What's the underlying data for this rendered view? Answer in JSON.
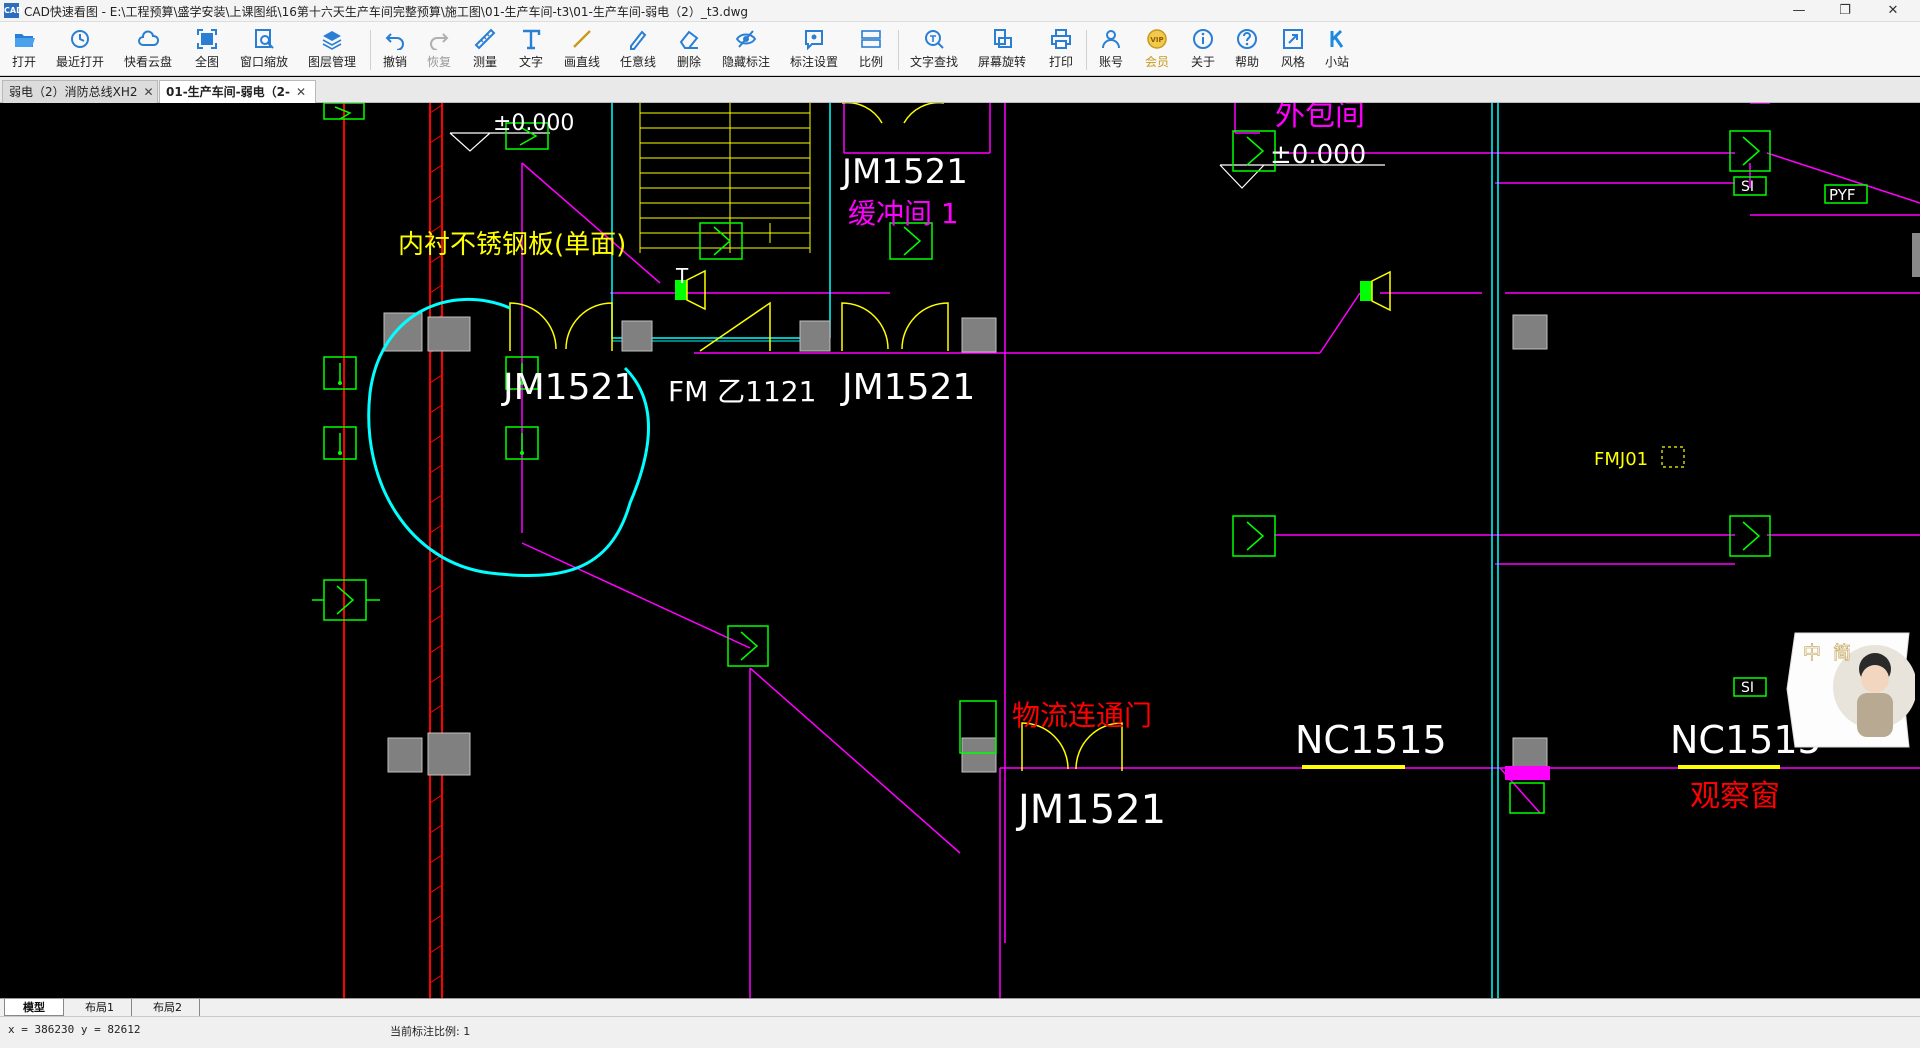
{
  "window": {
    "app_icon": "CAD",
    "title": "CAD快速看图 - E:\\工程预算\\盛学安装\\上课图纸\\16第十六天生产车间完整预算\\施工图\\01-生产车间-t3\\01-生产车间-弱电（2）_t3.dwg",
    "minimize_glyph": "—",
    "restore_glyph": "❐",
    "close_glyph": "✕"
  },
  "toolbar": {
    "items": [
      {
        "label": "打开",
        "icon": "folder-open-icon"
      },
      {
        "label": "最近打开",
        "icon": "history-icon"
      },
      {
        "label": "快看云盘",
        "icon": "cloud-icon"
      },
      {
        "label": "全图",
        "icon": "fit-all-icon"
      },
      {
        "label": "窗口缩放",
        "icon": "zoom-window-icon"
      },
      {
        "label": "图层管理",
        "icon": "layers-icon"
      },
      {
        "label": "撤销",
        "icon": "undo-icon"
      },
      {
        "label": "恢复",
        "icon": "redo-icon"
      },
      {
        "label": "测量",
        "icon": "measure-icon"
      },
      {
        "label": "文字",
        "icon": "text-icon"
      },
      {
        "label": "画直线",
        "icon": "line-icon"
      },
      {
        "label": "任意线",
        "icon": "freehand-icon"
      },
      {
        "label": "删除",
        "icon": "eraser-icon"
      },
      {
        "label": "隐藏标注",
        "icon": "hide-eye-icon"
      },
      {
        "label": "标注设置",
        "icon": "annotation-settings-icon"
      },
      {
        "label": "比例",
        "icon": "scale-icon"
      },
      {
        "label": "文字查找",
        "icon": "text-search-icon"
      },
      {
        "label": "屏幕旋转",
        "icon": "rotate-screen-icon"
      },
      {
        "label": "打印",
        "icon": "printer-icon"
      },
      {
        "label": "账号",
        "icon": "user-icon"
      },
      {
        "label": "会员",
        "icon": "vip-icon"
      },
      {
        "label": "关于",
        "icon": "info-icon"
      },
      {
        "label": "帮助",
        "icon": "help-icon"
      },
      {
        "label": "风格",
        "icon": "style-icon"
      },
      {
        "label": "小站",
        "icon": "site-k-icon"
      }
    ]
  },
  "doc_tabs": [
    {
      "label": "弱电（2）消防总线XH2",
      "close": "✕"
    },
    {
      "label": "01-生产车间-弱电（2-",
      "close": "✕"
    }
  ],
  "drawing": {
    "texts": {
      "elev_left": "±0.000",
      "elev_right": "±0.000",
      "liner_note": "内衬不锈钢板(单面)",
      "jm_top": "JM1521",
      "buffer_room": "缓冲间 1",
      "outsource_room": "外包间",
      "jm_left": "JM1521",
      "fm_door": "FM 乙1121",
      "jm_mid": "JM1521",
      "fmj": "FMJ01",
      "pyf": "PYF",
      "si_top": "SI",
      "si_mid": "SI",
      "logistics_door": "物流连通门",
      "jm_bottom": "JM1521",
      "nc_left": "NC1515",
      "nc_right": "NC1515",
      "observation_window": "观察窗",
      "t_mark": "T"
    },
    "colors": {
      "magenta": "#ff00ff",
      "green": "#00ff00",
      "yellow": "#ffff00",
      "cyan": "#00ffff",
      "red": "#ff0000",
      "gray": "#808080",
      "white": "#ffffff"
    }
  },
  "avatar_widget": {
    "chars": [
      "中",
      "简"
    ]
  },
  "layout_tabs": [
    "模型",
    "布局1",
    "布局2"
  ],
  "status": {
    "coords": "x = 386230  y = 82612",
    "annotation_scale": "当前标注比例: 1"
  }
}
